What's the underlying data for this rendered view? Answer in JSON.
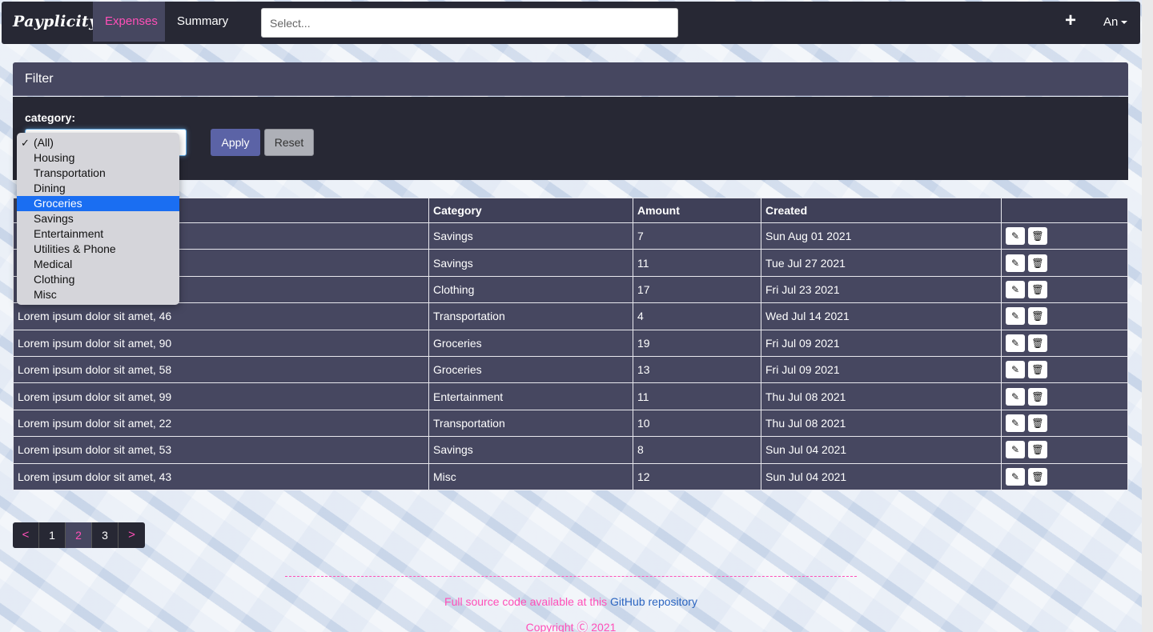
{
  "navbar": {
    "brand": "Payplicity",
    "tabs": [
      {
        "label": "Expenses",
        "active": true
      },
      {
        "label": "Summary",
        "active": false
      }
    ],
    "search_placeholder": "Select...",
    "add_icon": "plus-icon",
    "user": "An"
  },
  "filter": {
    "title": "Filter",
    "category_label": "category:",
    "apply_label": "Apply",
    "reset_label": "Reset",
    "options": [
      "(All)",
      "Housing",
      "Transportation",
      "Dining",
      "Groceries",
      "Savings",
      "Entertainment",
      "Utilities & Phone",
      "Medical",
      "Clothing",
      "Misc"
    ],
    "selected": "(All)",
    "highlighted": "Groceries"
  },
  "table": {
    "headers": [
      "",
      "Category",
      "Amount",
      "Created",
      ""
    ],
    "rows": [
      {
        "desc": "",
        "category": "Savings",
        "amount": "7",
        "created": "Sun Aug 01 2021"
      },
      {
        "desc": "",
        "category": "Savings",
        "amount": "11",
        "created": "Tue Jul 27 2021"
      },
      {
        "desc": "",
        "category": "Clothing",
        "amount": "17",
        "created": "Fri Jul 23 2021"
      },
      {
        "desc": "Lorem ipsum dolor sit amet, 46",
        "category": "Transportation",
        "amount": "4",
        "created": "Wed Jul 14 2021"
      },
      {
        "desc": "Lorem ipsum dolor sit amet, 90",
        "category": "Groceries",
        "amount": "19",
        "created": "Fri Jul 09 2021"
      },
      {
        "desc": "Lorem ipsum dolor sit amet, 58",
        "category": "Groceries",
        "amount": "13",
        "created": "Fri Jul 09 2021"
      },
      {
        "desc": "Lorem ipsum dolor sit amet, 99",
        "category": "Entertainment",
        "amount": "11",
        "created": "Thu Jul 08 2021"
      },
      {
        "desc": "Lorem ipsum dolor sit amet, 22",
        "category": "Transportation",
        "amount": "10",
        "created": "Thu Jul 08 2021"
      },
      {
        "desc": "Lorem ipsum dolor sit amet, 53",
        "category": "Savings",
        "amount": "8",
        "created": "Sun Jul 04 2021"
      },
      {
        "desc": "Lorem ipsum dolor sit amet, 43",
        "category": "Misc",
        "amount": "12",
        "created": "Sun Jul 04 2021"
      }
    ],
    "row_actions": [
      "edit-icon",
      "trash-icon"
    ]
  },
  "pagination": {
    "prev": "<",
    "pages": [
      "1",
      "2",
      "3"
    ],
    "current": "2",
    "next": ">"
  },
  "footer": {
    "text": "Full source code available at this ",
    "link": "GitHub repository",
    "copyright": "Copyright Ⓒ 2021"
  },
  "colors": {
    "nav_bg": "#272834",
    "panel_bg": "#464760",
    "accent_pink": "#ff4fb8",
    "apply_btn": "#5b63a6",
    "highlight": "#1a6ef2",
    "link": "#2a64c0"
  }
}
